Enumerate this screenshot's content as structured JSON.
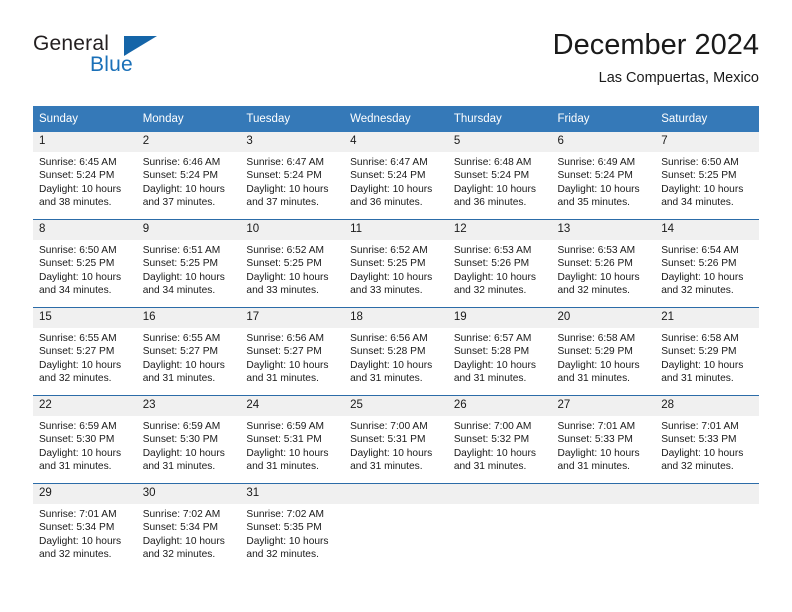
{
  "brand": {
    "word_one": "General",
    "word_two": "Blue",
    "accent_color": "#1a70b8"
  },
  "header": {
    "title": "December 2024",
    "subtitle": "Las Compuertas, Mexico"
  },
  "theme": {
    "header_bg": "#3579b8",
    "daynum_bg": "#f0f0f0",
    "row_divider": "#2c6ca8",
    "text": "#1a1a1a"
  },
  "weekday_headers": [
    "Sunday",
    "Monday",
    "Tuesday",
    "Wednesday",
    "Thursday",
    "Friday",
    "Saturday"
  ],
  "weeks": [
    [
      {
        "day": "1",
        "sunrise": "Sunrise: 6:45 AM",
        "sunset": "Sunset: 5:24 PM",
        "daylight_1": "Daylight: 10 hours",
        "daylight_2": "and 38 minutes."
      },
      {
        "day": "2",
        "sunrise": "Sunrise: 6:46 AM",
        "sunset": "Sunset: 5:24 PM",
        "daylight_1": "Daylight: 10 hours",
        "daylight_2": "and 37 minutes."
      },
      {
        "day": "3",
        "sunrise": "Sunrise: 6:47 AM",
        "sunset": "Sunset: 5:24 PM",
        "daylight_1": "Daylight: 10 hours",
        "daylight_2": "and 37 minutes."
      },
      {
        "day": "4",
        "sunrise": "Sunrise: 6:47 AM",
        "sunset": "Sunset: 5:24 PM",
        "daylight_1": "Daylight: 10 hours",
        "daylight_2": "and 36 minutes."
      },
      {
        "day": "5",
        "sunrise": "Sunrise: 6:48 AM",
        "sunset": "Sunset: 5:24 PM",
        "daylight_1": "Daylight: 10 hours",
        "daylight_2": "and 36 minutes."
      },
      {
        "day": "6",
        "sunrise": "Sunrise: 6:49 AM",
        "sunset": "Sunset: 5:24 PM",
        "daylight_1": "Daylight: 10 hours",
        "daylight_2": "and 35 minutes."
      },
      {
        "day": "7",
        "sunrise": "Sunrise: 6:50 AM",
        "sunset": "Sunset: 5:25 PM",
        "daylight_1": "Daylight: 10 hours",
        "daylight_2": "and 34 minutes."
      }
    ],
    [
      {
        "day": "8",
        "sunrise": "Sunrise: 6:50 AM",
        "sunset": "Sunset: 5:25 PM",
        "daylight_1": "Daylight: 10 hours",
        "daylight_2": "and 34 minutes."
      },
      {
        "day": "9",
        "sunrise": "Sunrise: 6:51 AM",
        "sunset": "Sunset: 5:25 PM",
        "daylight_1": "Daylight: 10 hours",
        "daylight_2": "and 34 minutes."
      },
      {
        "day": "10",
        "sunrise": "Sunrise: 6:52 AM",
        "sunset": "Sunset: 5:25 PM",
        "daylight_1": "Daylight: 10 hours",
        "daylight_2": "and 33 minutes."
      },
      {
        "day": "11",
        "sunrise": "Sunrise: 6:52 AM",
        "sunset": "Sunset: 5:25 PM",
        "daylight_1": "Daylight: 10 hours",
        "daylight_2": "and 33 minutes."
      },
      {
        "day": "12",
        "sunrise": "Sunrise: 6:53 AM",
        "sunset": "Sunset: 5:26 PM",
        "daylight_1": "Daylight: 10 hours",
        "daylight_2": "and 32 minutes."
      },
      {
        "day": "13",
        "sunrise": "Sunrise: 6:53 AM",
        "sunset": "Sunset: 5:26 PM",
        "daylight_1": "Daylight: 10 hours",
        "daylight_2": "and 32 minutes."
      },
      {
        "day": "14",
        "sunrise": "Sunrise: 6:54 AM",
        "sunset": "Sunset: 5:26 PM",
        "daylight_1": "Daylight: 10 hours",
        "daylight_2": "and 32 minutes."
      }
    ],
    [
      {
        "day": "15",
        "sunrise": "Sunrise: 6:55 AM",
        "sunset": "Sunset: 5:27 PM",
        "daylight_1": "Daylight: 10 hours",
        "daylight_2": "and 32 minutes."
      },
      {
        "day": "16",
        "sunrise": "Sunrise: 6:55 AM",
        "sunset": "Sunset: 5:27 PM",
        "daylight_1": "Daylight: 10 hours",
        "daylight_2": "and 31 minutes."
      },
      {
        "day": "17",
        "sunrise": "Sunrise: 6:56 AM",
        "sunset": "Sunset: 5:27 PM",
        "daylight_1": "Daylight: 10 hours",
        "daylight_2": "and 31 minutes."
      },
      {
        "day": "18",
        "sunrise": "Sunrise: 6:56 AM",
        "sunset": "Sunset: 5:28 PM",
        "daylight_1": "Daylight: 10 hours",
        "daylight_2": "and 31 minutes."
      },
      {
        "day": "19",
        "sunrise": "Sunrise: 6:57 AM",
        "sunset": "Sunset: 5:28 PM",
        "daylight_1": "Daylight: 10 hours",
        "daylight_2": "and 31 minutes."
      },
      {
        "day": "20",
        "sunrise": "Sunrise: 6:58 AM",
        "sunset": "Sunset: 5:29 PM",
        "daylight_1": "Daylight: 10 hours",
        "daylight_2": "and 31 minutes."
      },
      {
        "day": "21",
        "sunrise": "Sunrise: 6:58 AM",
        "sunset": "Sunset: 5:29 PM",
        "daylight_1": "Daylight: 10 hours",
        "daylight_2": "and 31 minutes."
      }
    ],
    [
      {
        "day": "22",
        "sunrise": "Sunrise: 6:59 AM",
        "sunset": "Sunset: 5:30 PM",
        "daylight_1": "Daylight: 10 hours",
        "daylight_2": "and 31 minutes."
      },
      {
        "day": "23",
        "sunrise": "Sunrise: 6:59 AM",
        "sunset": "Sunset: 5:30 PM",
        "daylight_1": "Daylight: 10 hours",
        "daylight_2": "and 31 minutes."
      },
      {
        "day": "24",
        "sunrise": "Sunrise: 6:59 AM",
        "sunset": "Sunset: 5:31 PM",
        "daylight_1": "Daylight: 10 hours",
        "daylight_2": "and 31 minutes."
      },
      {
        "day": "25",
        "sunrise": "Sunrise: 7:00 AM",
        "sunset": "Sunset: 5:31 PM",
        "daylight_1": "Daylight: 10 hours",
        "daylight_2": "and 31 minutes."
      },
      {
        "day": "26",
        "sunrise": "Sunrise: 7:00 AM",
        "sunset": "Sunset: 5:32 PM",
        "daylight_1": "Daylight: 10 hours",
        "daylight_2": "and 31 minutes."
      },
      {
        "day": "27",
        "sunrise": "Sunrise: 7:01 AM",
        "sunset": "Sunset: 5:33 PM",
        "daylight_1": "Daylight: 10 hours",
        "daylight_2": "and 31 minutes."
      },
      {
        "day": "28",
        "sunrise": "Sunrise: 7:01 AM",
        "sunset": "Sunset: 5:33 PM",
        "daylight_1": "Daylight: 10 hours",
        "daylight_2": "and 32 minutes."
      }
    ],
    [
      {
        "day": "29",
        "sunrise": "Sunrise: 7:01 AM",
        "sunset": "Sunset: 5:34 PM",
        "daylight_1": "Daylight: 10 hours",
        "daylight_2": "and 32 minutes."
      },
      {
        "day": "30",
        "sunrise": "Sunrise: 7:02 AM",
        "sunset": "Sunset: 5:34 PM",
        "daylight_1": "Daylight: 10 hours",
        "daylight_2": "and 32 minutes."
      },
      {
        "day": "31",
        "sunrise": "Sunrise: 7:02 AM",
        "sunset": "Sunset: 5:35 PM",
        "daylight_1": "Daylight: 10 hours",
        "daylight_2": "and 32 minutes."
      },
      {
        "day": "",
        "sunrise": "",
        "sunset": "",
        "daylight_1": "",
        "daylight_2": ""
      },
      {
        "day": "",
        "sunrise": "",
        "sunset": "",
        "daylight_1": "",
        "daylight_2": ""
      },
      {
        "day": "",
        "sunrise": "",
        "sunset": "",
        "daylight_1": "",
        "daylight_2": ""
      },
      {
        "day": "",
        "sunrise": "",
        "sunset": "",
        "daylight_1": "",
        "daylight_2": ""
      }
    ]
  ]
}
